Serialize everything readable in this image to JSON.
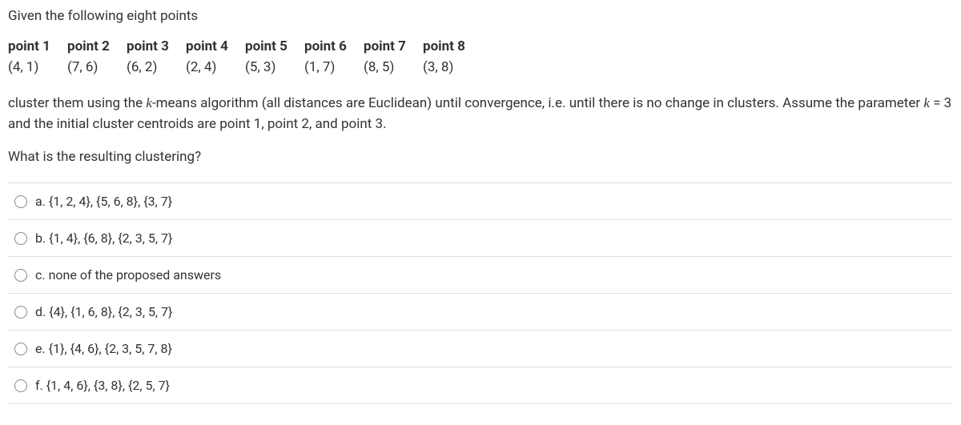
{
  "intro": "Given the following eight points",
  "headers": [
    "point 1",
    "point 2",
    "point 3",
    "point 4",
    "point 5",
    "point 6",
    "point 7",
    "point 8"
  ],
  "points": [
    "(4, 1)",
    "(7, 6)",
    "(6, 2)",
    "(2, 4)",
    "(5, 3)",
    "(1, 7)",
    "(8, 5)",
    "(3, 8)"
  ],
  "body_part1": "cluster them using the ",
  "body_math1": "k",
  "body_part2": "-means algorithm (all distances are Euclidean) until convergence, i.e. until there is no change in clusters. Assume the parameter ",
  "body_math2": "k",
  "body_eq": " = ",
  "body_k": "3",
  "body_part3": " and the initial cluster centroids are point 1, point 2, and point 3.",
  "question": "What is the resulting clustering?",
  "options": {
    "a": "a. {1, 2, 4}, {5, 6, 8}, {3, 7}",
    "b": "b. {1, 4}, {6, 8}, {2, 3, 5, 7}",
    "c": "c. none of the proposed answers",
    "d": "d. {4}, {1, 6, 8}, {2, 3, 5, 7}",
    "e": "e. {1}, {4, 6}, {2, 3, 5, 7, 8}",
    "f": "f. {1, 4, 6}, {3, 8}, {2, 5, 7}"
  }
}
